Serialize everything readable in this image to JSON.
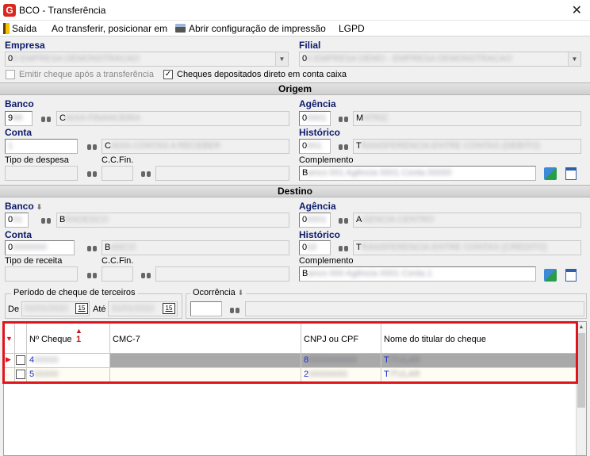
{
  "window": {
    "title": "BCO - Transferência",
    "close": "✕"
  },
  "menu": {
    "exit": "Saída",
    "on_transfer": "Ao transferir, posicionar em",
    "print_config": "Abrir configuração de impressão",
    "lgpd": "LGPD"
  },
  "top": {
    "empresa_label": "Empresa",
    "empresa_value": "0",
    "filial_label": "Filial",
    "filial_value": "0",
    "emit_cheque_label": "Emitir cheque após a transferência",
    "cheques_dep_label": "Cheques depositados direto em conta caixa",
    "cheques_dep_checked": "✓"
  },
  "origem": {
    "section": "Origem",
    "banco_label": "Banco",
    "banco_value": "9",
    "banco_desc": "C",
    "agencia_label": "Agência",
    "agencia_value": "0",
    "agencia_desc": "M",
    "conta_label": "Conta",
    "conta_desc": "C",
    "historico_label": "Histórico",
    "historico_value": "0",
    "historico_desc": "T",
    "tipo_label": "Tipo de despesa",
    "ccfin_label": "C.C.Fin.",
    "complemento_label": "Complemento",
    "complemento_value": "B"
  },
  "destino": {
    "section": "Destino",
    "banco_label": "Banco",
    "banco_value": "0",
    "banco_desc": "B",
    "agencia_label": "Agência",
    "agencia_value": "0",
    "agencia_desc": "A",
    "conta_label": "Conta",
    "conta_value": "0",
    "conta_desc": "B",
    "historico_label": "Histórico",
    "historico_value": "0",
    "historico_desc": "T",
    "tipo_label": "Tipo de receita",
    "ccfin_label": "C.C.Fin.",
    "complemento_label": "Complemento",
    "complemento_value": "B"
  },
  "filters": {
    "periodo_label": "Período de cheque de terceiros",
    "de_label": "De",
    "ate_label": "Até",
    "cal_day": "15",
    "ocorrencia_label": "Ocorrência"
  },
  "grid": {
    "sort_marker": "1",
    "columns": [
      "Nº Cheque",
      "CMC-7",
      "CNPJ ou CPF",
      "Nome do titular do cheque"
    ],
    "rows": [
      {
        "cheque": "4",
        "cmc7": "",
        "cnpj": "8",
        "nome": "T"
      },
      {
        "cheque": "5",
        "cmc7": "",
        "cnpj": "2",
        "nome": "T"
      }
    ]
  },
  "colors": {
    "highlight": "#e0141c",
    "label_blue": "#0c1a6b",
    "link_blue": "#1a2fd1"
  }
}
